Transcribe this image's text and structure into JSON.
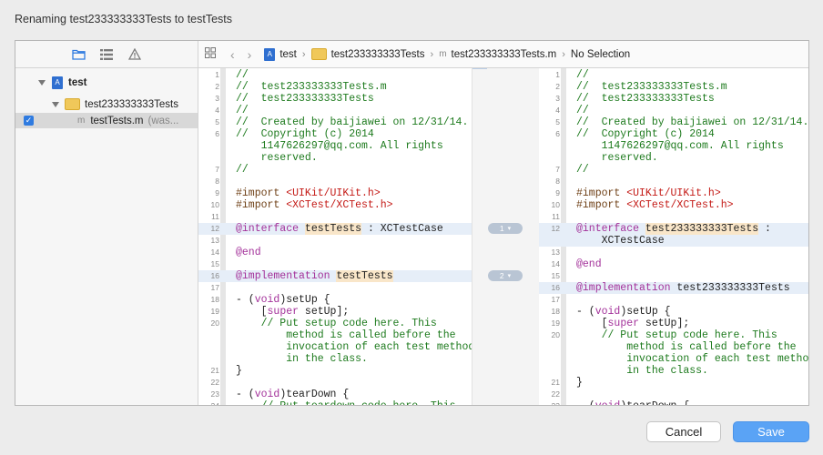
{
  "window": {
    "title": "Renaming test233333333Tests to testTests"
  },
  "sidebar": {
    "tabs": [
      {
        "icon": "folder-icon",
        "active": true
      },
      {
        "icon": "list-icon",
        "active": false
      },
      {
        "icon": "warning-icon",
        "active": false
      }
    ],
    "tree": [
      {
        "label": "test",
        "icon": "project-icon",
        "level": 0
      },
      {
        "label": "test233333333Tests",
        "icon": "folder-icon",
        "level": 1
      },
      {
        "label": "testTests.m",
        "suffix": "(was...",
        "icon": "file-icon",
        "level": 2,
        "checked": true,
        "selected": true
      }
    ]
  },
  "jumpbar": {
    "crumbs": [
      "test",
      "test233333333Tests",
      "test233333333Tests.m",
      "No Selection"
    ]
  },
  "left_pane": {
    "lines": [
      {
        "n": "1",
        "parts": [
          {
            "t": "//",
            "c": "c-cmt"
          }
        ]
      },
      {
        "n": "2",
        "parts": [
          {
            "t": "//  test233333333Tests.m",
            "c": "c-cmt"
          }
        ]
      },
      {
        "n": "3",
        "parts": [
          {
            "t": "//  test233333333Tests",
            "c": "c-cmt"
          }
        ]
      },
      {
        "n": "4",
        "parts": [
          {
            "t": "//",
            "c": "c-cmt"
          }
        ]
      },
      {
        "n": "5",
        "parts": [
          {
            "t": "//  Created by baijiawei on 12/31/14.",
            "c": "c-cmt"
          }
        ]
      },
      {
        "n": "6",
        "parts": [
          {
            "t": "//  Copyright (c) 2014",
            "c": "c-cmt"
          }
        ]
      },
      {
        "n": "",
        "parts": [
          {
            "t": "    1147626297@qq.com. All rights",
            "c": "c-cmt"
          }
        ]
      },
      {
        "n": "",
        "parts": [
          {
            "t": "    reserved.",
            "c": "c-cmt"
          }
        ]
      },
      {
        "n": "7",
        "parts": [
          {
            "t": "//",
            "c": "c-cmt"
          }
        ]
      },
      {
        "n": "8",
        "parts": []
      },
      {
        "n": "9",
        "parts": [
          {
            "t": "#import ",
            "c": "c-pp"
          },
          {
            "t": "<UIKit/UIKit.h>",
            "c": "c-str"
          }
        ]
      },
      {
        "n": "10",
        "parts": [
          {
            "t": "#import ",
            "c": "c-pp"
          },
          {
            "t": "<XCTest/XCTest.h>",
            "c": "c-str"
          }
        ]
      },
      {
        "n": "11",
        "parts": []
      },
      {
        "n": "12",
        "row": true,
        "parts": [
          {
            "t": "@interface ",
            "c": "c-kw"
          },
          {
            "t": "testTests",
            "c": "hl"
          },
          {
            "t": " : XCTestCase",
            "c": ""
          }
        ]
      },
      {
        "n": "13",
        "parts": []
      },
      {
        "n": "14",
        "parts": [
          {
            "t": "@end",
            "c": "c-kw"
          }
        ]
      },
      {
        "n": "15",
        "parts": []
      },
      {
        "n": "16",
        "row": true,
        "parts": [
          {
            "t": "@implementation ",
            "c": "c-kw"
          },
          {
            "t": "testTests",
            "c": "hl"
          }
        ]
      },
      {
        "n": "17",
        "parts": []
      },
      {
        "n": "18",
        "parts": [
          {
            "t": "- (",
            "c": ""
          },
          {
            "t": "void",
            "c": "c-kw"
          },
          {
            "t": ")setUp {",
            "c": ""
          }
        ]
      },
      {
        "n": "19",
        "parts": [
          {
            "t": "    [",
            "c": ""
          },
          {
            "t": "super",
            "c": "c-kw"
          },
          {
            "t": " setUp];",
            "c": ""
          }
        ]
      },
      {
        "n": "20",
        "parts": [
          {
            "t": "    // Put setup code here. This",
            "c": "c-cmt"
          }
        ]
      },
      {
        "n": "",
        "parts": [
          {
            "t": "        method is called before the",
            "c": "c-cmt"
          }
        ]
      },
      {
        "n": "",
        "parts": [
          {
            "t": "        invocation of each test method",
            "c": "c-cmt"
          }
        ]
      },
      {
        "n": "",
        "parts": [
          {
            "t": "        in the class.",
            "c": "c-cmt"
          }
        ]
      },
      {
        "n": "21",
        "parts": [
          {
            "t": "}",
            "c": ""
          }
        ]
      },
      {
        "n": "22",
        "parts": []
      },
      {
        "n": "23",
        "parts": [
          {
            "t": "- (",
            "c": ""
          },
          {
            "t": "void",
            "c": "c-kw"
          },
          {
            "t": ")tearDown {",
            "c": ""
          }
        ]
      },
      {
        "n": "24",
        "parts": [
          {
            "t": "    // Put teardown code here. This",
            "c": "c-cmt"
          }
        ]
      }
    ]
  },
  "right_pane": {
    "lines": [
      {
        "n": "1",
        "parts": [
          {
            "t": "//",
            "c": "c-cmt"
          }
        ]
      },
      {
        "n": "2",
        "parts": [
          {
            "t": "//  test233333333Tests.m",
            "c": "c-cmt"
          }
        ]
      },
      {
        "n": "3",
        "parts": [
          {
            "t": "//  test233333333Tests",
            "c": "c-cmt"
          }
        ]
      },
      {
        "n": "4",
        "parts": [
          {
            "t": "//",
            "c": "c-cmt"
          }
        ]
      },
      {
        "n": "5",
        "parts": [
          {
            "t": "//  Created by baijiawei on 12/31/14.",
            "c": "c-cmt"
          }
        ]
      },
      {
        "n": "6",
        "parts": [
          {
            "t": "//  Copyright (c) 2014",
            "c": "c-cmt"
          }
        ]
      },
      {
        "n": "",
        "parts": [
          {
            "t": "    1147626297@qq.com. All rights",
            "c": "c-cmt"
          }
        ]
      },
      {
        "n": "",
        "parts": [
          {
            "t": "    reserved.",
            "c": "c-cmt"
          }
        ]
      },
      {
        "n": "7",
        "parts": [
          {
            "t": "//",
            "c": "c-cmt"
          }
        ]
      },
      {
        "n": "8",
        "parts": []
      },
      {
        "n": "9",
        "parts": [
          {
            "t": "#import ",
            "c": "c-pp"
          },
          {
            "t": "<UIKit/UIKit.h>",
            "c": "c-str"
          }
        ]
      },
      {
        "n": "10",
        "parts": [
          {
            "t": "#import ",
            "c": "c-pp"
          },
          {
            "t": "<XCTest/XCTest.h>",
            "c": "c-str"
          }
        ]
      },
      {
        "n": "11",
        "parts": []
      },
      {
        "n": "12",
        "row": true,
        "parts": [
          {
            "t": "@interface ",
            "c": "c-kw"
          },
          {
            "t": "test233333333Tests",
            "c": "hl"
          },
          {
            "t": " :",
            "c": ""
          }
        ]
      },
      {
        "n": "",
        "row": true,
        "parts": [
          {
            "t": "    XCTestCase",
            "c": ""
          }
        ]
      },
      {
        "n": "13",
        "parts": []
      },
      {
        "n": "14",
        "parts": [
          {
            "t": "@end",
            "c": "c-kw"
          }
        ]
      },
      {
        "n": "15",
        "parts": []
      },
      {
        "n": "16",
        "row": true,
        "parts": [
          {
            "t": "@implementation ",
            "c": "c-kw"
          },
          {
            "t": "test233333333Tests",
            "c": ""
          }
        ]
      },
      {
        "n": "17",
        "parts": []
      },
      {
        "n": "18",
        "parts": [
          {
            "t": "- (",
            "c": ""
          },
          {
            "t": "void",
            "c": "c-kw"
          },
          {
            "t": ")setUp {",
            "c": ""
          }
        ]
      },
      {
        "n": "19",
        "parts": [
          {
            "t": "    [",
            "c": ""
          },
          {
            "t": "super",
            "c": "c-kw"
          },
          {
            "t": " setUp];",
            "c": ""
          }
        ]
      },
      {
        "n": "20",
        "parts": [
          {
            "t": "    // Put setup code here. This",
            "c": "c-cmt"
          }
        ]
      },
      {
        "n": "",
        "parts": [
          {
            "t": "        method is called before the",
            "c": "c-cmt"
          }
        ]
      },
      {
        "n": "",
        "parts": [
          {
            "t": "        invocation of each test method",
            "c": "c-cmt"
          }
        ]
      },
      {
        "n": "",
        "parts": [
          {
            "t": "        in the class.",
            "c": "c-cmt"
          }
        ]
      },
      {
        "n": "21",
        "parts": [
          {
            "t": "}",
            "c": ""
          }
        ]
      },
      {
        "n": "22",
        "parts": []
      },
      {
        "n": "23",
        "parts": [
          {
            "t": "- (",
            "c": ""
          },
          {
            "t": "void",
            "c": "c-kw"
          },
          {
            "t": ")tearDown {",
            "c": ""
          }
        ]
      }
    ]
  },
  "changes": [
    {
      "label": "1"
    },
    {
      "label": "2"
    }
  ],
  "buttons": {
    "cancel": "Cancel",
    "save": "Save"
  }
}
